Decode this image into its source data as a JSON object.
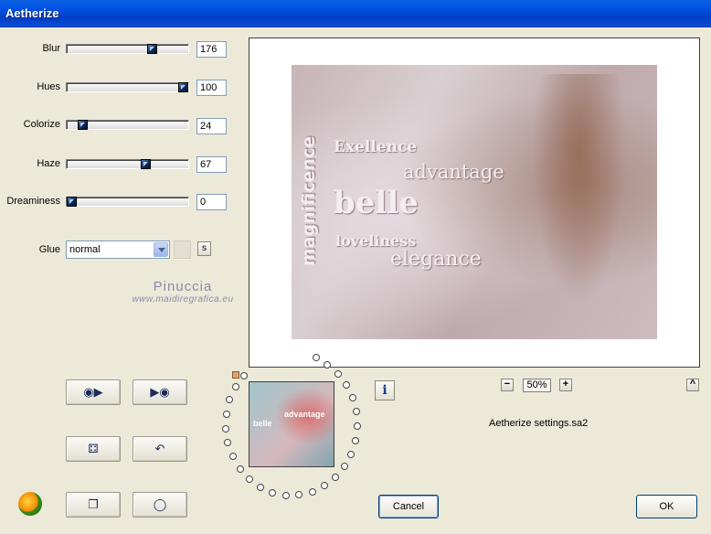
{
  "window": {
    "title": "Aetherize"
  },
  "sliders": [
    {
      "label": "Blur",
      "value": "176",
      "fraction": 0.72
    },
    {
      "label": "Hues",
      "value": "100",
      "fraction": 1.0
    },
    {
      "label": "Colorize",
      "value": "24",
      "fraction": 0.1
    },
    {
      "label": "Haze",
      "value": "67",
      "fraction": 0.66
    },
    {
      "label": "Dreaminess",
      "value": "0",
      "fraction": 0.0
    }
  ],
  "glue": {
    "label": "Glue",
    "value": "normal",
    "s_button": "s"
  },
  "watermark": {
    "name": "Pinuccia",
    "url": "www.maidiregrafica.eu"
  },
  "preview_text": {
    "vertical": "magnificence",
    "w1": "Exellence",
    "w2": "advantage",
    "w3": "belle",
    "w4": "loveliness",
    "w5": "elegance"
  },
  "thumbnail_text": {
    "t1": "belle",
    "t2": "advantage"
  },
  "icons": {
    "open": "disc-play-icon",
    "save": "play-disc-icon",
    "random": "dice-icon",
    "undo": "undo-arrow-icon",
    "copy": "document-icon",
    "reset": "ring-icon",
    "info": "info-icon",
    "logo": "flame-logo-icon"
  },
  "info_label": "i",
  "zoom": {
    "minus": "−",
    "value": "50%",
    "plus": "+",
    "up": "^"
  },
  "settings_file": "Aetherize settings.sa2",
  "buttons": {
    "cancel": "Cancel",
    "ok": "OK"
  }
}
